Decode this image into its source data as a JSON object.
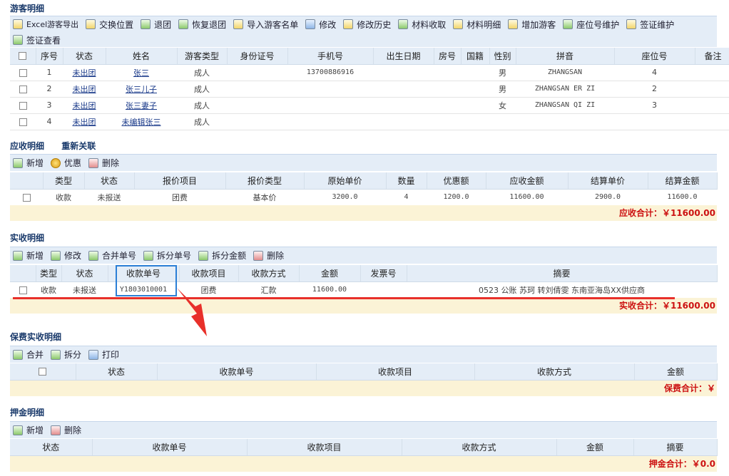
{
  "tourists": {
    "title": "游客明细",
    "toolbar": [
      "Excel游客导出",
      "交换位置",
      "退团",
      "恢复退团",
      "导入游客名单",
      "修改",
      "修改历史",
      "材料收取",
      "材料明细",
      "增加游客",
      "座位号维护",
      "签证维护",
      "签证查看"
    ],
    "columns": [
      "序号",
      "状态",
      "姓名",
      "游客类型",
      "身份证号",
      "手机号",
      "出生日期",
      "房号",
      "国籍",
      "性别",
      "拼音",
      "座位号",
      "备注"
    ],
    "rows": [
      {
        "no": "1",
        "status": "未出团",
        "name": "张三",
        "type": "成人",
        "id": "",
        "phone": "13700886916",
        "birth": "",
        "room": "",
        "nation": "",
        "sex": "男",
        "pinyin": "ZHANGSAN",
        "seat": "4",
        "remark": ""
      },
      {
        "no": "2",
        "status": "未出团",
        "name": "张三儿子",
        "type": "成人",
        "id": "",
        "phone": "",
        "birth": "",
        "room": "",
        "nation": "",
        "sex": "男",
        "pinyin": "ZHANGSAN ER ZI",
        "seat": "2",
        "remark": ""
      },
      {
        "no": "3",
        "status": "未出团",
        "name": "张三妻子",
        "type": "成人",
        "id": "",
        "phone": "",
        "birth": "",
        "room": "",
        "nation": "",
        "sex": "女",
        "pinyin": "ZHANGSAN QI ZI",
        "seat": "3",
        "remark": ""
      },
      {
        "no": "4",
        "status": "未出团",
        "name": "未编辑张三",
        "type": "成人",
        "id": "",
        "phone": "",
        "birth": "",
        "room": "",
        "nation": "",
        "sex": "",
        "pinyin": "",
        "seat": "",
        "remark": ""
      }
    ]
  },
  "receivable": {
    "title": "应收明细",
    "relink": "重新关联",
    "toolbar": [
      "新增",
      "优惠",
      "删除"
    ],
    "columns": [
      "类型",
      "状态",
      "报价项目",
      "报价类型",
      "原始单价",
      "数量",
      "优惠额",
      "应收金额",
      "结算单价",
      "结算金额"
    ],
    "rows": [
      {
        "type": "收款",
        "status": "未报送",
        "item": "团费",
        "ptype": "基本价",
        "price": "3200.0",
        "qty": "4",
        "discount": "1200.0",
        "amount": "11600.00",
        "sprice": "2900.0",
        "samount": "11600.0"
      }
    ],
    "total": "应收合计：￥11600.00"
  },
  "received": {
    "title": "实收明细",
    "toolbar": [
      "新增",
      "修改",
      "合并单号",
      "拆分单号",
      "拆分金额",
      "删除"
    ],
    "columns": [
      "类型",
      "状态",
      "收款单号",
      "收款项目",
      "收款方式",
      "金额",
      "发票号",
      "摘要"
    ],
    "rows": [
      {
        "type": "收款",
        "status": "未报送",
        "billno": "Y1803010001",
        "item": "团费",
        "method": "汇款",
        "amount": "11600.00",
        "invoice": "",
        "summary": "0523 公账 苏珂 转刘倩雯 东南亚海岛XX供应商"
      }
    ],
    "total": "实收合计：￥11600.00"
  },
  "insurance": {
    "title": "保费实收明细",
    "toolbar": [
      "合并",
      "拆分",
      "打印"
    ],
    "columns": [
      "状态",
      "收款单号",
      "收款项目",
      "收款方式",
      "金额"
    ],
    "total": "保费合计：￥"
  },
  "deposit": {
    "title": "押金明细",
    "toolbar": [
      "新增",
      "删除"
    ],
    "columns": [
      "状态",
      "收款单号",
      "收款项目",
      "收款方式",
      "金额",
      "摘要"
    ],
    "total": "押金合计：￥0.0"
  },
  "colors": {
    "annotation_red": "#e8302a",
    "highlight_blue": "#2b7fd6",
    "total_red": "#cc1111"
  }
}
